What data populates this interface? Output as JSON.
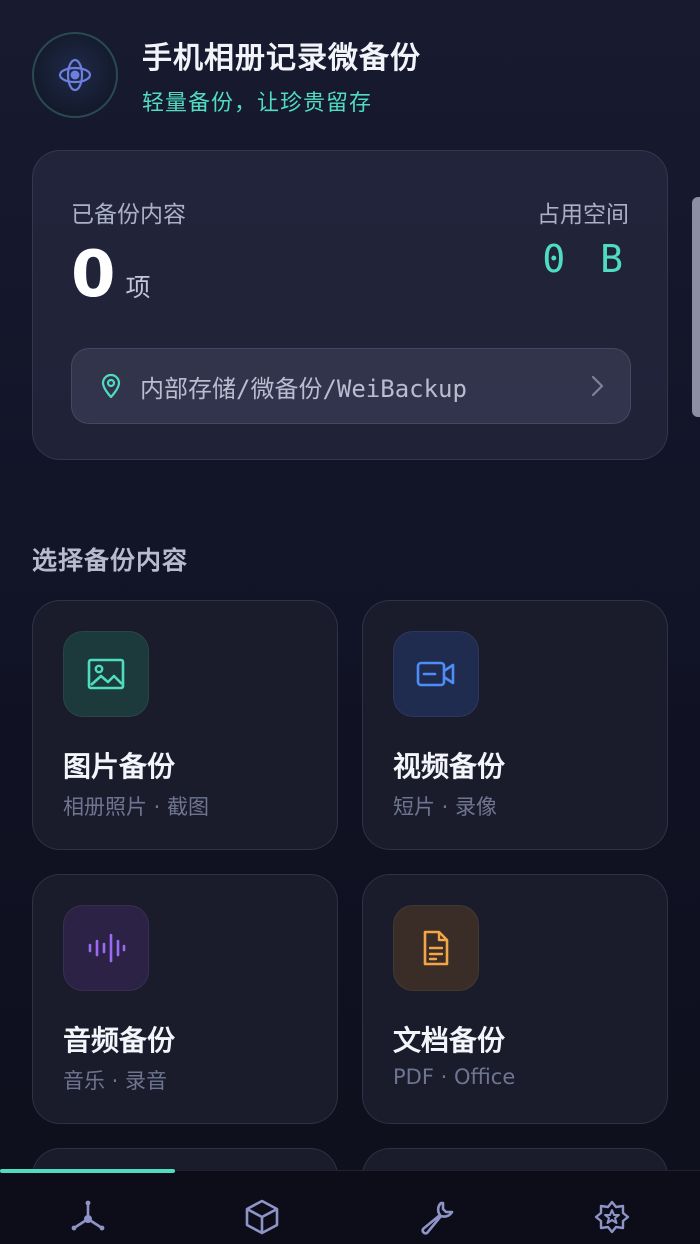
{
  "app": {
    "title": "手机相册记录微备份",
    "subtitle": "轻量备份，让珍贵留存",
    "logo_icon": "atom-icon"
  },
  "stats": {
    "backed_up_label": "已备份内容",
    "backed_up_count": "0",
    "backed_up_unit": "项",
    "space_label": "占用空间",
    "space_value": "0 B",
    "path": "内部存储/微备份/WeiBackup",
    "path_icon": "location-pin-icon",
    "path_chevron": "chevron-right-icon"
  },
  "section": {
    "title": "选择备份内容"
  },
  "tiles": [
    {
      "title": "图片备份",
      "subtitle": "相册照片 · 截图",
      "icon": "image-icon",
      "color": "#4fdcc0"
    },
    {
      "title": "视频备份",
      "subtitle": "短片 · 录像",
      "icon": "video-camera-icon",
      "color": "#4d8df5"
    },
    {
      "title": "音频备份",
      "subtitle": "音乐 · 录音",
      "icon": "audio-wave-icon",
      "color": "#9a6bf2"
    },
    {
      "title": "文档备份",
      "subtitle": "PDF · Office",
      "icon": "document-icon",
      "color": "#f2a647"
    }
  ],
  "nav": {
    "items": [
      {
        "icon": "nodes-icon",
        "active": true
      },
      {
        "icon": "cube-icon",
        "active": false
      },
      {
        "icon": "wrench-icon",
        "active": false
      },
      {
        "icon": "star-badge-icon",
        "active": false
      }
    ],
    "accent": "#4fdcc0"
  }
}
